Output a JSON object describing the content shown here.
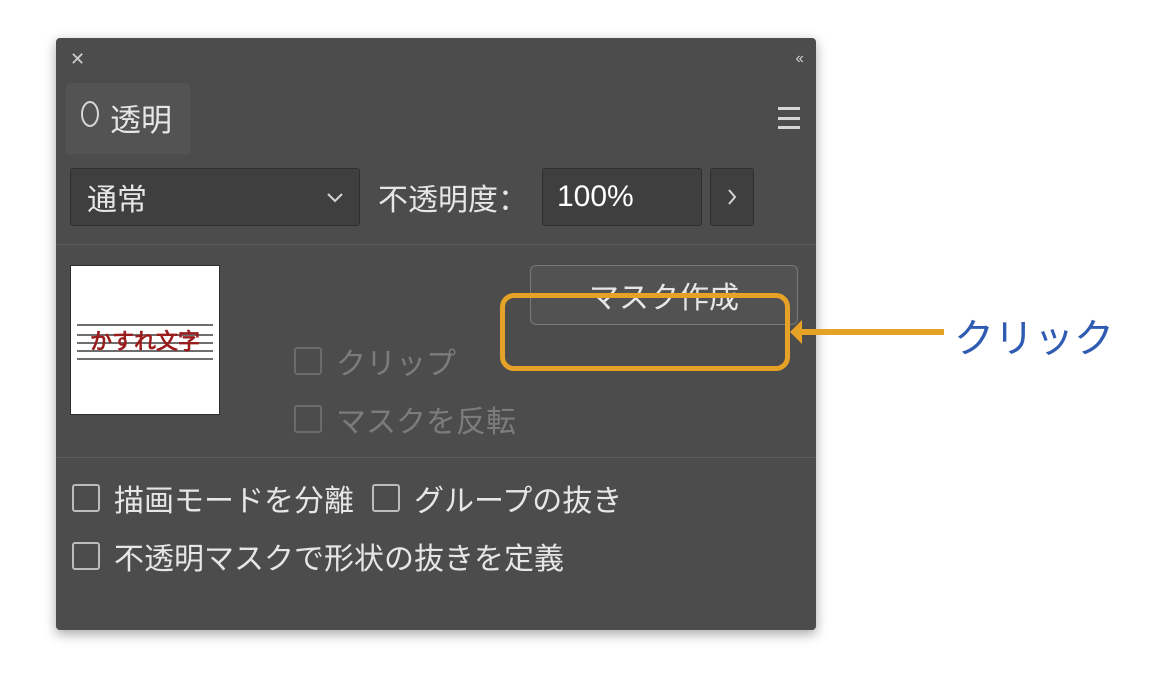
{
  "panel": {
    "title": "透明"
  },
  "blend": {
    "selected": "通常"
  },
  "opacity": {
    "label": "不透明度：",
    "value": "100%"
  },
  "thumbnail": {
    "text": "かすれ文字"
  },
  "mask": {
    "button": "マスク作成",
    "clip": "クリップ",
    "invert": "マスクを反転"
  },
  "bottom": {
    "isolate": "描画モードを分離",
    "knockout": "グループの抜き",
    "define": "不透明マスクで形状の抜きを定義"
  },
  "callout": "クリック"
}
